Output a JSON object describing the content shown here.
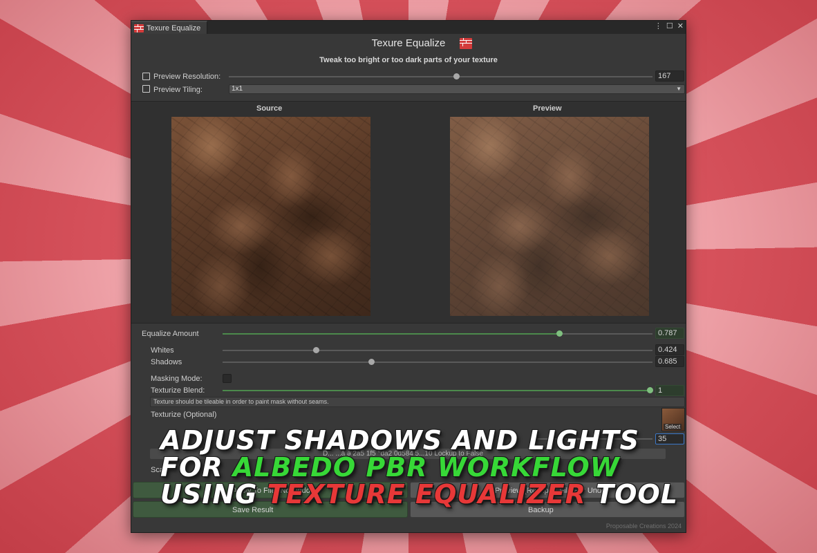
{
  "window": {
    "tab_title": "Texure Equalize",
    "menu_icon": "kebab-menu-icon",
    "maximize_icon": "maximize-icon",
    "close_icon": "close-icon",
    "close_glyph": "✕",
    "menu_glyph": "⋮",
    "maximize_glyph": "☐"
  },
  "header": {
    "title": "Texure Equalize",
    "subtitle": "Tweak too bright or too dark parts of your texture",
    "icon": "brick-wall-icon"
  },
  "preview_resolution": {
    "label": "Preview Resolution:",
    "value": "167",
    "level": 0.55
  },
  "preview_tiling": {
    "label": "Preview Tiling:",
    "selected": "1x1"
  },
  "preview": {
    "source_label": "Source",
    "preview_label": "Preview"
  },
  "controls": {
    "equalize_amount": {
      "label": "Equalize Amount",
      "value": "0.787",
      "level": 0.787
    },
    "whites": {
      "label": "Whites",
      "value": "0.424",
      "level": 0.22
    },
    "shadows": {
      "label": "Shadows",
      "value": "0.685",
      "level": 0.345
    },
    "masking_mode": {
      "label": "Masking Mode:",
      "checked": false
    },
    "texturize_blend": {
      "label": "Texturize Blend:",
      "value": "1",
      "level": 1.0
    },
    "hint": "Texture should be tileable in order to paint mask without seams.",
    "texturize": {
      "label": "Texturize (Optional)",
      "select_label": "Select"
    },
    "tile_value": "35",
    "path_text": "D...   ...ă ə 2a5 1f5 °da2 0d584 5...10 Lockup to False",
    "scale_label": "Sca"
  },
  "buttons": {
    "apply_to_file": "Apply To File (No Undo)",
    "preview_reimport": "Preview (Reimport File For Undo)",
    "save_result": "Save Result",
    "backup": "Backup"
  },
  "footer": "Proposable Creations 2024",
  "overlay": {
    "line1": "ADJUST SHADOWS AND LIGHTS",
    "line2_prefix": "FOR ",
    "line2_highlight": "ALBEDO PBR WORKFLOW",
    "line3_prefix": "USING ",
    "line3_highlight": "TEXTURE EQUALIZER",
    "line3_suffix": " TOOL",
    "colors": {
      "green": "#37d837",
      "red": "#e73838",
      "white": "#ffffff"
    }
  }
}
